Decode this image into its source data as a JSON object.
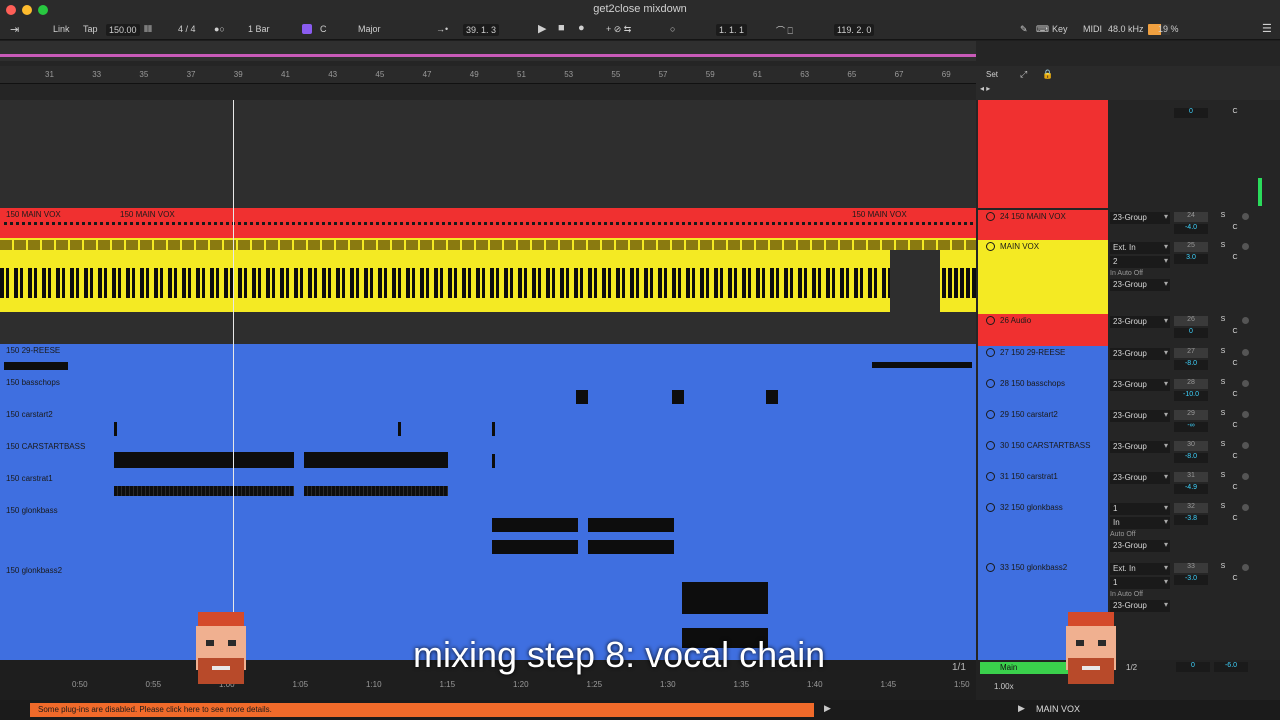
{
  "window": {
    "title": "get2close mixdown"
  },
  "controlbar": {
    "link": "Link",
    "tap": "Tap",
    "tempo": "150.00",
    "signature": "4 / 4",
    "quantize": "1 Bar",
    "key": "C",
    "scale": "Major",
    "position": "39.   1.   3",
    "loop_start": "1.   1.   1",
    "loop_length": "119.   2.   0",
    "key_label": "Key",
    "midi_label": "MIDI",
    "sample_rate": "48.0 kHz",
    "cpu": "19 %"
  },
  "ruler": {
    "bars": [
      "31",
      "33",
      "35",
      "37",
      "39",
      "41",
      "43",
      "45",
      "47",
      "49",
      "51",
      "53",
      "55",
      "57",
      "59",
      "61",
      "63",
      "65",
      "67",
      "69"
    ]
  },
  "set_panel": {
    "label": "Set"
  },
  "tracks": [
    {
      "name": "150 MAIN VOX",
      "name2": "150 MAIN VOX",
      "name3": "150 MAIN VOX",
      "color": "#f03030"
    },
    {
      "name": "150 29-REESE",
      "color": "#3f6fe0"
    },
    {
      "name": "150 basschops",
      "color": "#3f6fe0"
    },
    {
      "name": "150 carstart2",
      "color": "#3f6fe0"
    },
    {
      "name": "150 CARSTARTBASS",
      "color": "#3f6fe0"
    },
    {
      "name": "150 carstrat1",
      "color": "#3f6fe0"
    },
    {
      "name": "150 glonkbass",
      "color": "#3f6fe0"
    },
    {
      "name": "150 glonkbass2",
      "color": "#3f6fe0"
    }
  ],
  "mixer": {
    "rows": [
      {
        "title": "24 150 MAIN VOX",
        "io": "23-Group",
        "num": "24",
        "vol": "-4.0",
        "pan": "C"
      },
      {
        "title": "MAIN VOX",
        "io": "Ext. In",
        "io2": "2",
        "io3": "23-Group",
        "num": "25",
        "vol": "3.0",
        "pan": "C",
        "in": "In",
        "auto": "Auto",
        "off": "Off"
      },
      {
        "title": "26 Audio",
        "io": "23-Group",
        "num": "26",
        "vol": "0",
        "pan": "C"
      },
      {
        "title": "27 150 29-REESE",
        "io": "23-Group",
        "num": "27",
        "vol": "-8.0",
        "pan": "C"
      },
      {
        "title": "28 150 basschops",
        "io": "23-Group",
        "num": "28",
        "vol": "-10.0",
        "pan": "C"
      },
      {
        "title": "29 150 carstart2",
        "io": "23-Group",
        "num": "29",
        "vol": "-∞",
        "pan": "C"
      },
      {
        "title": "30 150 CARSTARTBASS",
        "io": "23-Group",
        "num": "30",
        "vol": "-8.0",
        "pan": "C"
      },
      {
        "title": "31 150 carstrat1",
        "io": "23-Group",
        "num": "31",
        "vol": "-4.9",
        "pan": "C"
      },
      {
        "title": "32 150 glonkbass",
        "io": "1",
        "io2": "In",
        "io3": "23-Group",
        "num": "32",
        "vol": "-3.8",
        "pan": "C",
        "auto": "Auto",
        "off": "Off"
      },
      {
        "title": "33 150 glonkbass2",
        "io": "Ext. In",
        "io2": "1",
        "io3": "23-Group",
        "num": "33",
        "vol": "-3.0",
        "pan": "C",
        "in": "In",
        "auto": "Auto",
        "off": "Off"
      }
    ],
    "top_vol": "0",
    "top_pan": "C",
    "solo": "S"
  },
  "timeline": {
    "times": [
      "0:50",
      "0:55",
      "1:00",
      "1:05",
      "1:10",
      "1:15",
      "1:20",
      "1:25",
      "1:30",
      "1:35",
      "1:40",
      "1:45",
      "1:50"
    ]
  },
  "main_strip": {
    "counter": "1/1",
    "name": "Main",
    "ratio": "1/2",
    "vol": "0",
    "vol2": "-6.0",
    "zoom": "1.00x"
  },
  "status": {
    "warning": "Some plug-ins are disabled. Please click here to see more details.",
    "track": "MAIN VOX"
  },
  "caption": "mixing step 8: vocal chain"
}
